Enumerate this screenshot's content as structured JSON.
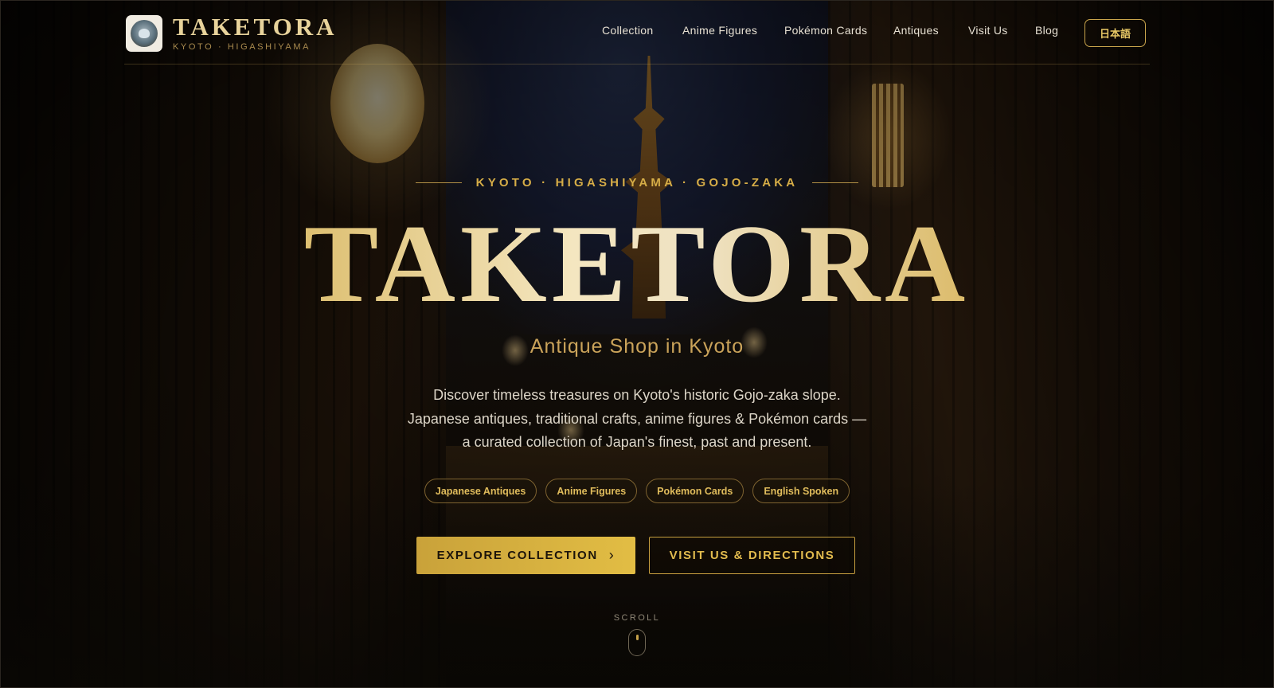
{
  "brand": {
    "name": "TAKETORA",
    "subtitle": "KYOTO · HIGASHIYAMA"
  },
  "nav": {
    "items": [
      {
        "label": "Collection"
      },
      {
        "label": "Anime Figures"
      },
      {
        "label": "Pokémon Cards"
      },
      {
        "label": "Antiques"
      },
      {
        "label": "Visit Us"
      },
      {
        "label": "Blog"
      }
    ],
    "language_button": "日本語"
  },
  "hero": {
    "eyebrow": "KYOTO · HIGASHIYAMA · GOJO-ZAKA",
    "title": "TAKETORA",
    "subtitle": "Antique Shop in Kyoto",
    "description_lines": [
      "Discover timeless treasures on Kyoto's historic Gojo-zaka slope.",
      "Japanese antiques, traditional crafts, anime figures & Pokémon cards —",
      "a curated collection of Japan's finest, past and present."
    ],
    "tags": [
      "Japanese Antiques",
      "Anime Figures",
      "Pokémon Cards",
      "English Spoken"
    ],
    "primary_cta": "EXPLORE COLLECTION",
    "primary_cta_icon": "chevron-right-icon",
    "secondary_cta": "VISIT US & DIRECTIONS",
    "scroll_label": "SCROLL"
  },
  "colors": {
    "accent_gold": "#d6ad47",
    "background": "#0b0906",
    "text_light": "#e7e0d2"
  }
}
